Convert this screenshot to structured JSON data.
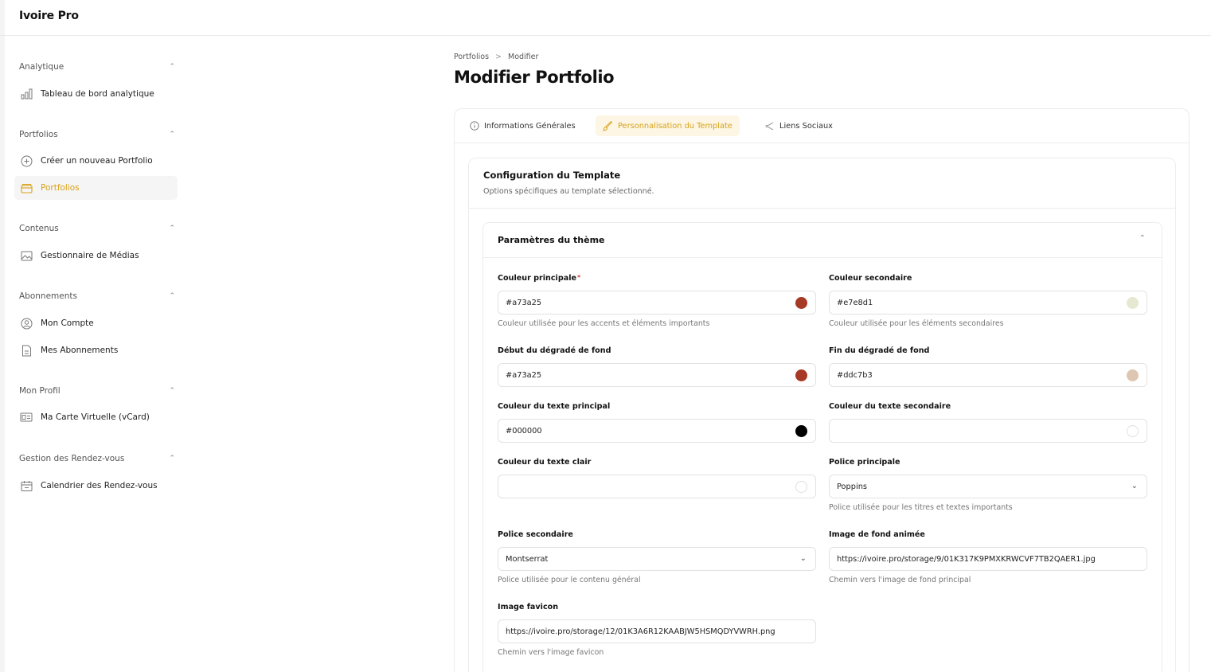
{
  "app": {
    "title": "Ivoire Pro"
  },
  "sidebar": {
    "sections": [
      {
        "title": "Analytique",
        "items": [
          {
            "label": "Tableau de bord analytique",
            "icon": "bar-chart-icon"
          }
        ]
      },
      {
        "title": "Portfolios",
        "items": [
          {
            "label": "Créer un nouveau Portfolio",
            "icon": "plus-circle-icon"
          },
          {
            "label": "Portfolios",
            "icon": "folder-icon",
            "active": true
          }
        ]
      },
      {
        "title": "Contenus",
        "items": [
          {
            "label": "Gestionnaire de Médias",
            "icon": "image-icon"
          }
        ]
      },
      {
        "title": "Abonnements",
        "items": [
          {
            "label": "Mon Compte",
            "icon": "user-circle-icon"
          },
          {
            "label": "Mes Abonnements",
            "icon": "document-icon"
          }
        ]
      },
      {
        "title": "Mon Profil",
        "items": [
          {
            "label": "Ma Carte Virtuelle (vCard)",
            "icon": "id-card-icon"
          }
        ]
      },
      {
        "title": "Gestion des Rendez-vous",
        "items": [
          {
            "label": "Calendrier des Rendez-vous",
            "icon": "calendar-icon"
          }
        ]
      }
    ]
  },
  "breadcrumb": {
    "items": [
      "Portfolios",
      "Modifier"
    ],
    "separator": ">"
  },
  "page": {
    "title": "Modifier Portfolio"
  },
  "tabs": [
    {
      "label": "Informations Générales",
      "icon": "info-icon"
    },
    {
      "label": "Personnalisation du Template",
      "icon": "brush-icon",
      "active": true
    },
    {
      "label": "Liens Sociaux",
      "icon": "share-icon"
    }
  ],
  "config": {
    "title": "Configuration du Template",
    "subtitle": "Options spécifiques au template sélectionné."
  },
  "theme": {
    "title": "Paramètres du thème",
    "fields": {
      "primary_color": {
        "label": "Couleur principale",
        "value": "#a73a25",
        "help": "Couleur utilisée pour les accents et éléments importants",
        "swatch": "#a73a25"
      },
      "secondary_color": {
        "label": "Couleur secondaire",
        "value": "#e7e8d1",
        "help": "Couleur utilisée pour les éléments secondaires",
        "swatch": "#e7e8d1"
      },
      "gradient_start": {
        "label": "Début du dégradé de fond",
        "value": "#a73a25",
        "swatch": "#a73a25"
      },
      "gradient_end": {
        "label": "Fin du dégradé de fond",
        "value": "#ddc7b3",
        "swatch": "#ddc7b3"
      },
      "text_primary": {
        "label": "Couleur du texte principal",
        "value": "#000000",
        "swatch": "#000000"
      },
      "text_secondary": {
        "label": "Couleur du texte secondaire",
        "value": ""
      },
      "text_light": {
        "label": "Couleur du texte clair",
        "value": ""
      },
      "font_primary": {
        "label": "Police principale",
        "value": "Poppins",
        "help": "Police utilisée pour les titres et textes importants"
      },
      "font_secondary": {
        "label": "Police secondaire",
        "value": "Montserrat",
        "help": "Police utilisée pour le contenu général"
      },
      "bg_image": {
        "label": "Image de fond animée",
        "value": "https://ivoire.pro/storage/9/01K317K9PMXKRWCVF7TB2QAER1.jpg",
        "help": "Chemin vers l'image de fond principal"
      },
      "favicon": {
        "label": "Image favicon",
        "value": "https://ivoire.pro/storage/12/01K3A6R12KAABJW5HSMQDYVWRH.png",
        "help": "Chemin vers l'image favicon"
      }
    }
  },
  "colors": {
    "accent": "#d8a21b",
    "required": "#d63b2b"
  }
}
